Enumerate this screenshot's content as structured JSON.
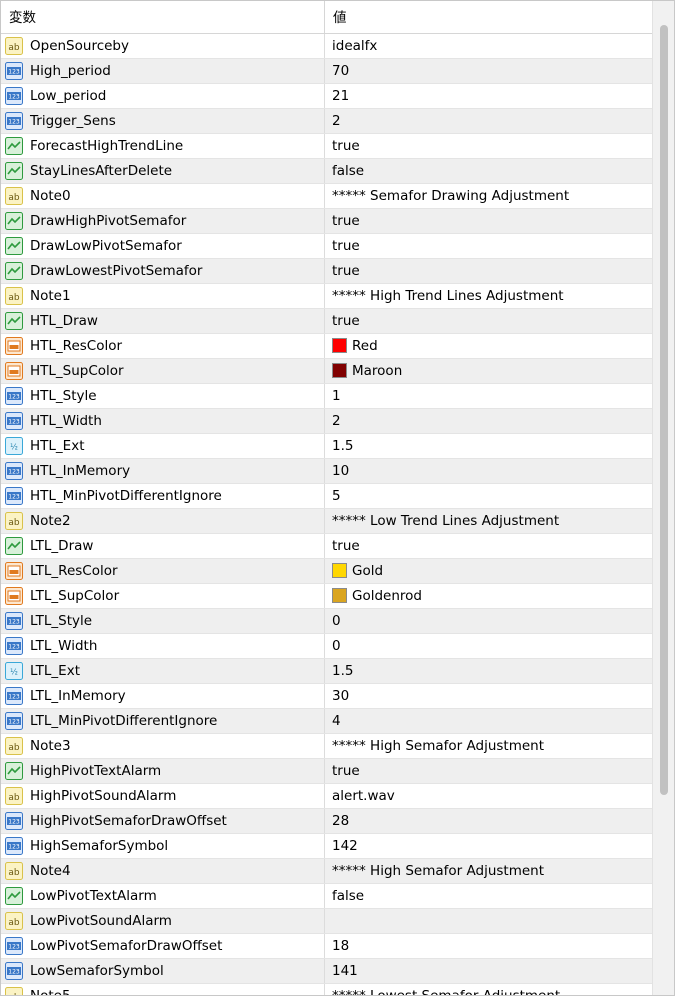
{
  "header": {
    "name_col": "変数",
    "value_col": "値"
  },
  "rows": [
    {
      "icon": "string",
      "name": "OpenSourceby",
      "value": "idealfx"
    },
    {
      "icon": "int",
      "name": "High_period",
      "value": "70"
    },
    {
      "icon": "int",
      "name": "Low_period",
      "value": "21"
    },
    {
      "icon": "int",
      "name": "Trigger_Sens",
      "value": "2"
    },
    {
      "icon": "bool",
      "name": "ForecastHighTrendLine",
      "value": "true"
    },
    {
      "icon": "bool",
      "name": "StayLinesAfterDelete",
      "value": "false"
    },
    {
      "icon": "string",
      "name": "Note0",
      "value": "***** Semafor Drawing Adjustment"
    },
    {
      "icon": "bool",
      "name": "DrawHighPivotSemafor",
      "value": "true"
    },
    {
      "icon": "bool",
      "name": "DrawLowPivotSemafor",
      "value": "true"
    },
    {
      "icon": "bool",
      "name": "DrawLowestPivotSemafor",
      "value": "true"
    },
    {
      "icon": "string",
      "name": "Note1",
      "value": "***** High Trend Lines Adjustment"
    },
    {
      "icon": "bool",
      "name": "HTL_Draw",
      "value": "true"
    },
    {
      "icon": "color",
      "name": "HTL_ResColor",
      "value": "Red",
      "swatch": "#ff0000"
    },
    {
      "icon": "color",
      "name": "HTL_SupColor",
      "value": "Maroon",
      "swatch": "#800000"
    },
    {
      "icon": "int",
      "name": "HTL_Style",
      "value": "1"
    },
    {
      "icon": "int",
      "name": "HTL_Width",
      "value": "2"
    },
    {
      "icon": "double",
      "name": "HTL_Ext",
      "value": "1.5"
    },
    {
      "icon": "int",
      "name": "HTL_InMemory",
      "value": "10"
    },
    {
      "icon": "int",
      "name": "HTL_MinPivotDifferentIgnore",
      "value": "5"
    },
    {
      "icon": "string",
      "name": "Note2",
      "value": "***** Low Trend Lines Adjustment"
    },
    {
      "icon": "bool",
      "name": "LTL_Draw",
      "value": "true"
    },
    {
      "icon": "color",
      "name": "LTL_ResColor",
      "value": "Gold",
      "swatch": "#ffd700"
    },
    {
      "icon": "color",
      "name": "LTL_SupColor",
      "value": "Goldenrod",
      "swatch": "#daa520"
    },
    {
      "icon": "int",
      "name": "LTL_Style",
      "value": "0"
    },
    {
      "icon": "int",
      "name": "LTL_Width",
      "value": "0"
    },
    {
      "icon": "double",
      "name": "LTL_Ext",
      "value": "1.5"
    },
    {
      "icon": "int",
      "name": "LTL_InMemory",
      "value": "30"
    },
    {
      "icon": "int",
      "name": "LTL_MinPivotDifferentIgnore",
      "value": "4"
    },
    {
      "icon": "string",
      "name": "Note3",
      "value": "***** High Semafor Adjustment"
    },
    {
      "icon": "bool",
      "name": "HighPivotTextAlarm",
      "value": "true"
    },
    {
      "icon": "string",
      "name": "HighPivotSoundAlarm",
      "value": "alert.wav"
    },
    {
      "icon": "int",
      "name": "HighPivotSemaforDrawOffset",
      "value": "28"
    },
    {
      "icon": "int",
      "name": "HighSemaforSymbol",
      "value": "142"
    },
    {
      "icon": "string",
      "name": "Note4",
      "value": "***** High Semafor Adjustment"
    },
    {
      "icon": "bool",
      "name": "LowPivotTextAlarm",
      "value": "false"
    },
    {
      "icon": "string",
      "name": "LowPivotSoundAlarm",
      "value": ""
    },
    {
      "icon": "int",
      "name": "LowPivotSemaforDrawOffset",
      "value": "18"
    },
    {
      "icon": "int",
      "name": "LowSemaforSymbol",
      "value": "141"
    },
    {
      "icon": "string",
      "name": "Note5",
      "value": "***** Lowest Semafor Adjustment"
    }
  ],
  "icon_colors": {
    "string": "#d9c24a",
    "int": "#3a78c8",
    "double": "#3aa8d8",
    "bool": "#2e9a3e",
    "color": "#e07a1f"
  }
}
